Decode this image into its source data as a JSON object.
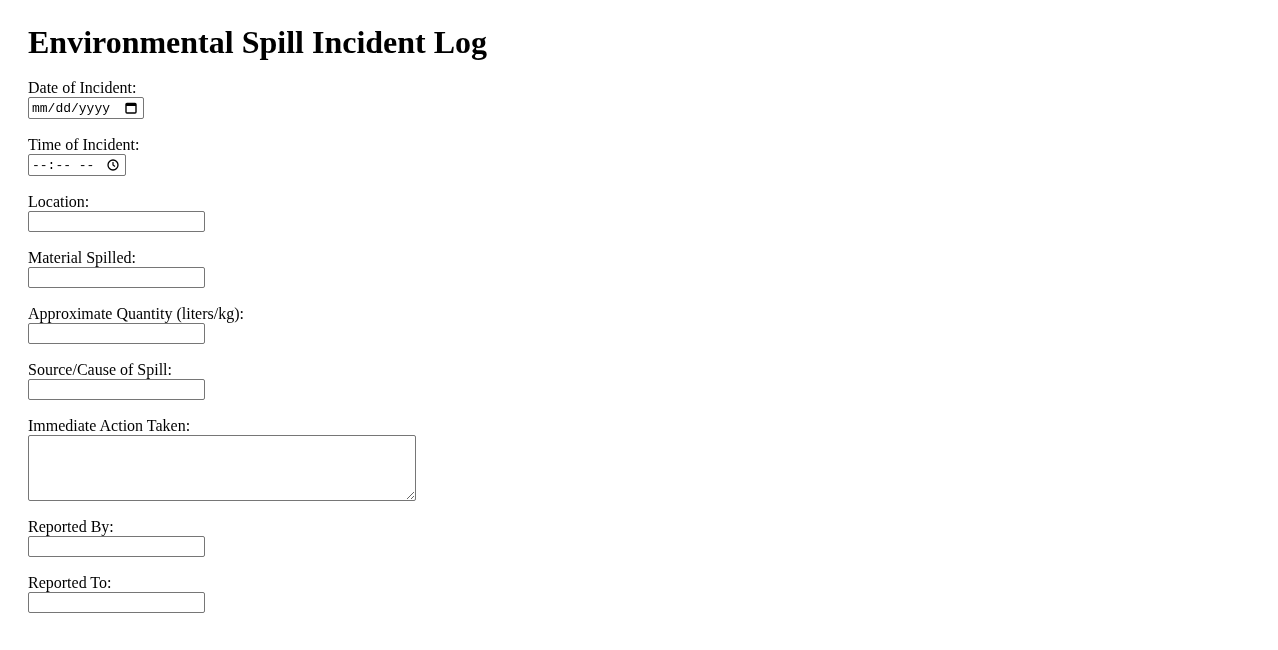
{
  "title": "Environmental Spill Incident Log",
  "fields": [
    {
      "label": "Date of Incident:",
      "kind": "date",
      "placeholder": "mm/dd/yyyy"
    },
    {
      "label": "Time of Incident:",
      "kind": "time",
      "placeholder": "--:-- --"
    },
    {
      "label": "Location:",
      "kind": "text"
    },
    {
      "label": "Material Spilled:",
      "kind": "text"
    },
    {
      "label": "Approximate Quantity (liters/kg):",
      "kind": "text"
    },
    {
      "label": "Source/Cause of Spill:",
      "kind": "text"
    },
    {
      "label": "Immediate Action Taken:",
      "kind": "textarea"
    },
    {
      "label": "Reported By:",
      "kind": "text"
    },
    {
      "label": "Reported To:",
      "kind": "text"
    }
  ]
}
